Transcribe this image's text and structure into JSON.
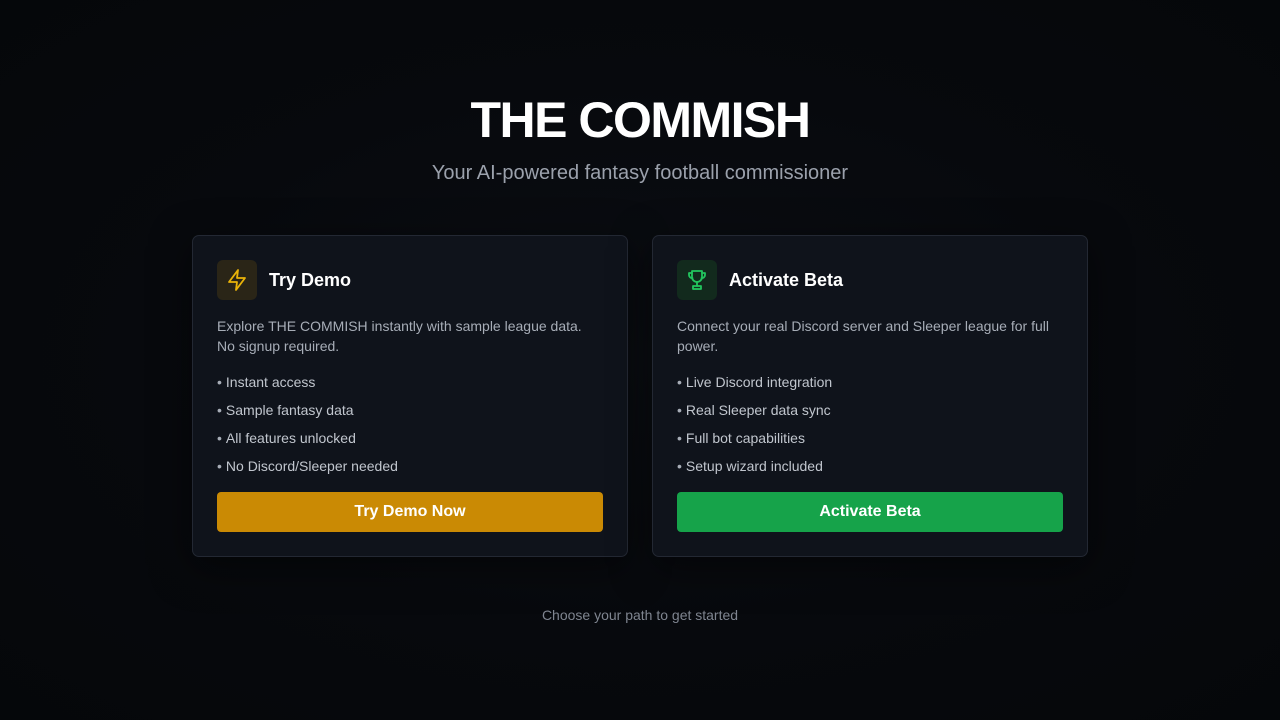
{
  "hero": {
    "title": "THE COMMISH",
    "subtitle": "Your AI-powered fantasy football commissioner"
  },
  "cards": {
    "demo": {
      "icon": "lightning-bolt-icon",
      "title": "Try Demo",
      "description": "Explore THE COMMISH instantly with sample league data. No signup required.",
      "features": [
        "Instant access",
        "Sample fantasy data",
        "All features unlocked",
        "No Discord/Sleeper needed"
      ],
      "button_label": "Try Demo Now",
      "accent": "#ca8a04"
    },
    "beta": {
      "icon": "trophy-icon",
      "title": "Activate Beta",
      "description": "Connect your real Discord server and Sleeper league for full power.",
      "features": [
        "Live Discord integration",
        "Real Sleeper data sync",
        "Full bot capabilities",
        "Setup wizard included"
      ],
      "button_label": "Activate Beta",
      "accent": "#16a34a"
    }
  },
  "footer": {
    "note": "Choose your path to get started"
  },
  "colors": {
    "background": "#06080c",
    "card_background": "#0f131b",
    "demo_accent": "#ca8a04",
    "beta_accent": "#16a34a"
  }
}
